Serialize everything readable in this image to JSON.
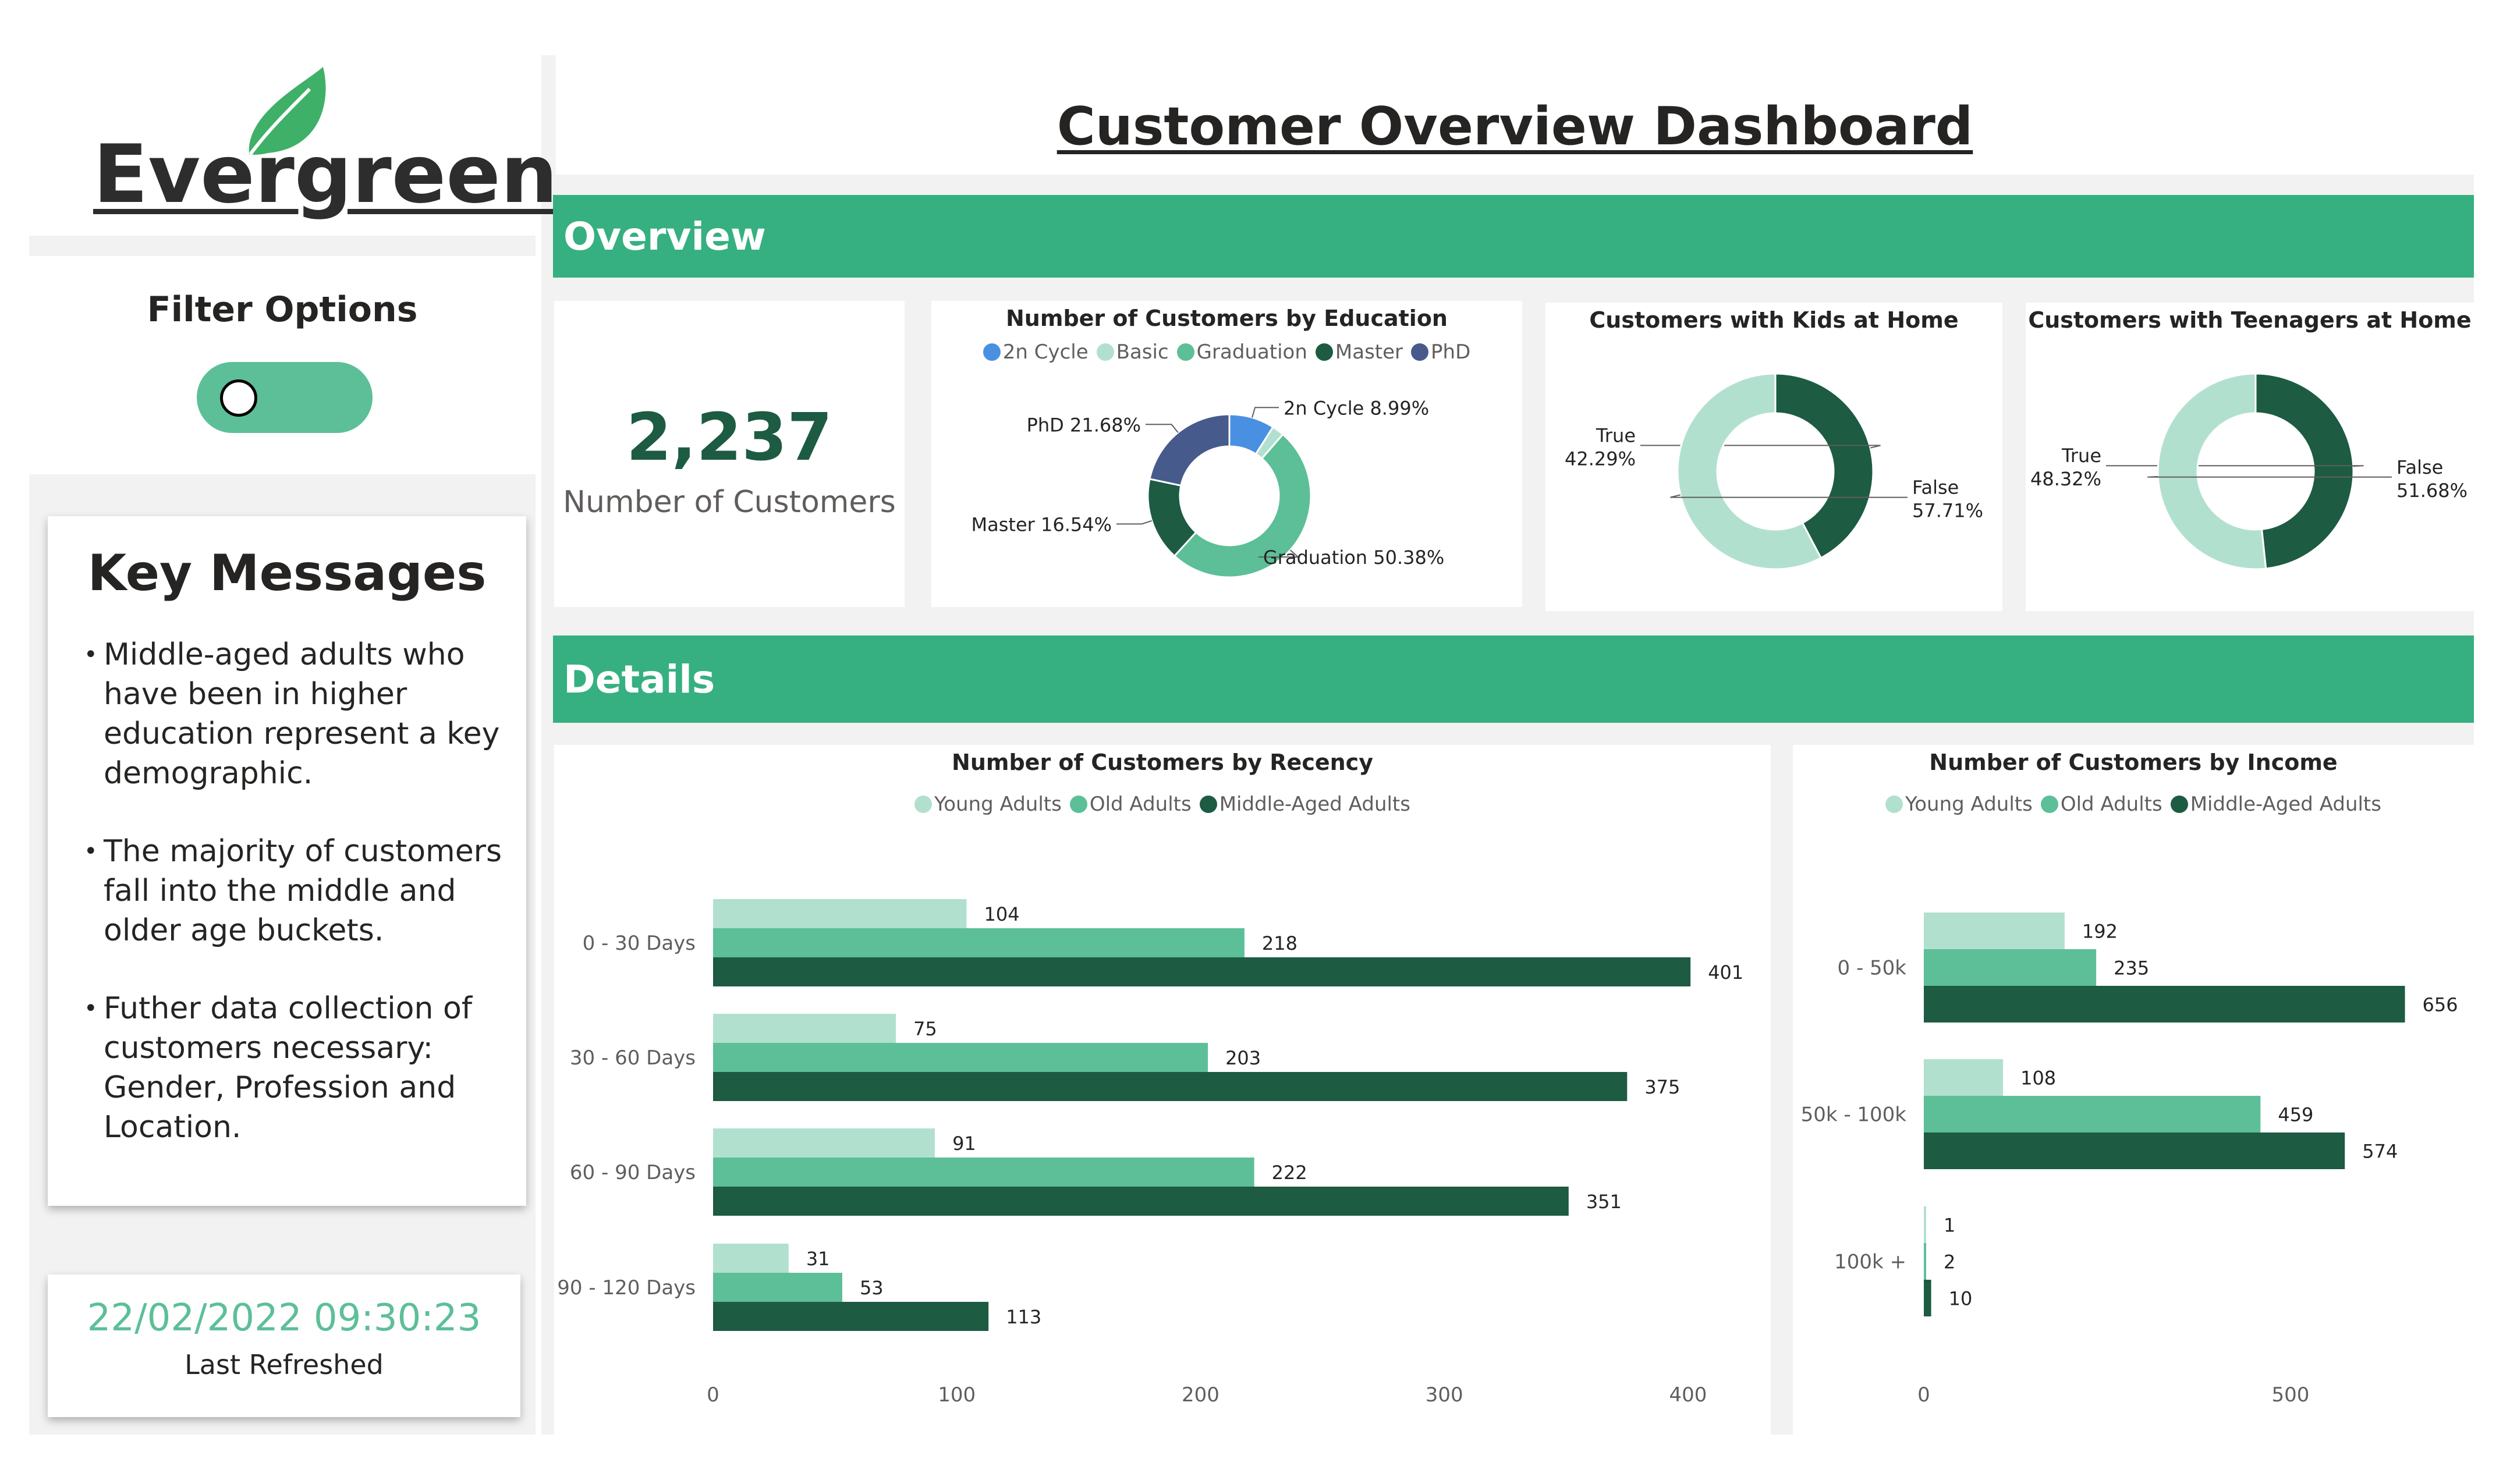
{
  "brand": {
    "name": "Evergreen",
    "accent": "#36b080",
    "dark": "#1d5b43"
  },
  "header": {
    "title": "Customer Overview Dashboard"
  },
  "filters": {
    "title": "Filter Options",
    "toggle_on": false
  },
  "key_messages": {
    "title": "Key Messages",
    "items": [
      "Middle-aged adults who have been in higher education represent a key demographic.",
      "The majority of customers fall into the middle and older age buckets.",
      "Futher data collection of customers necessary: Gender, Profession and Location."
    ]
  },
  "refresh": {
    "timestamp": "22/02/2022 09:30:23",
    "label": "Last Refreshed"
  },
  "sections": {
    "overview": "Overview",
    "details": "Details"
  },
  "kpi": {
    "value": "2,237",
    "label": "Number of Customers"
  },
  "chart_data": [
    {
      "id": "education",
      "type": "pie",
      "title": "Number of Customers by Education",
      "legend_position": "top",
      "labels": [
        "2n Cycle",
        "Basic",
        "Graduation",
        "Master",
        "PhD"
      ],
      "values": [
        8.99,
        2.41,
        50.38,
        16.54,
        21.68
      ],
      "data_labels": [
        "2n Cycle 8.99%",
        "",
        "Graduation 50.38%",
        "Master 16.54%",
        "PhD 21.68%"
      ],
      "colors": [
        "#4a90e2",
        "#b2e0cf",
        "#5cbf98",
        "#1d5b43",
        "#475a8c"
      ]
    },
    {
      "id": "kids",
      "type": "pie",
      "title": "Customers with Kids at Home",
      "labels": [
        "True",
        "False"
      ],
      "values": [
        42.29,
        57.71
      ],
      "data_labels": [
        "42.29%",
        "57.71%"
      ],
      "colors": [
        "#1d5b43",
        "#b2e0cf"
      ]
    },
    {
      "id": "teens",
      "type": "pie",
      "title": "Customers with Teenagers at Home",
      "labels": [
        "True",
        "False"
      ],
      "values": [
        48.32,
        51.68
      ],
      "data_labels": [
        "48.32%",
        "51.68%"
      ],
      "colors": [
        "#1d5b43",
        "#b2e0cf"
      ]
    },
    {
      "id": "recency",
      "type": "bar",
      "orientation": "horizontal",
      "title": "Number of Customers by Recency",
      "legend_position": "top",
      "categories": [
        "0 - 30 Days",
        "30 - 60 Days",
        "60 - 90 Days",
        "90 - 120 Days"
      ],
      "series": [
        {
          "name": "Young Adults",
          "color": "#b2e0cf",
          "values": [
            104,
            75,
            91,
            31
          ]
        },
        {
          "name": "Old Adults",
          "color": "#5cbf98",
          "values": [
            218,
            203,
            222,
            53
          ]
        },
        {
          "name": "Middle-Aged Adults",
          "color": "#1d5b43",
          "values": [
            401,
            375,
            351,
            113
          ]
        }
      ],
      "xlim": [
        0,
        400
      ],
      "xticks": [
        0,
        100,
        200,
        300,
        400
      ]
    },
    {
      "id": "income",
      "type": "bar",
      "orientation": "horizontal",
      "title": "Number of Customers by Income",
      "legend_position": "top",
      "categories": [
        "0 - 50k",
        "50k - 100k",
        "100k +"
      ],
      "series": [
        {
          "name": "Young Adults",
          "color": "#b2e0cf",
          "values": [
            192,
            108,
            1
          ]
        },
        {
          "name": "Old Adults",
          "color": "#5cbf98",
          "values": [
            235,
            459,
            2
          ]
        },
        {
          "name": "Middle-Aged Adults",
          "color": "#1d5b43",
          "values": [
            656,
            574,
            10
          ]
        }
      ],
      "xlim": [
        0,
        500
      ],
      "xticks": [
        0,
        500
      ]
    }
  ]
}
